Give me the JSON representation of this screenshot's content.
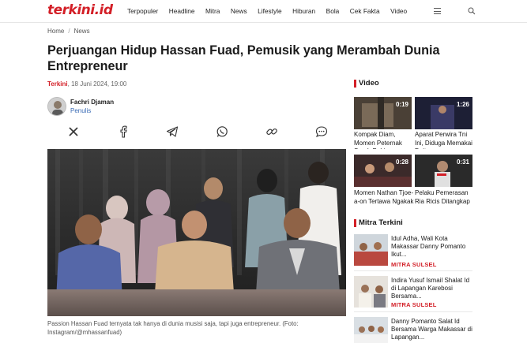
{
  "header": {
    "logo": "terkini.id",
    "nav": [
      "Terpopuler",
      "Headline",
      "Mitra",
      "News",
      "Lifestyle",
      "Hiburan",
      "Bola",
      "Cek Fakta",
      "Video"
    ],
    "menu_icon": "hamburger-icon",
    "search_icon": "search-icon"
  },
  "breadcrumb": {
    "home": "Home",
    "separator": "/",
    "section": "News"
  },
  "article": {
    "title": "Perjuangan Hidup Hassan Fuad, Pemusik yang Merambah Dunia Entrepreneur",
    "source": "Terkini",
    "date": ", 18 Juni 2024, 19:00",
    "author": {
      "name": "Fachri Djaman",
      "role": "Penulis"
    },
    "share_icons": [
      "x-icon",
      "facebook-icon",
      "telegram-icon",
      "whatsapp-icon",
      "link-icon",
      "comment-icon"
    ],
    "caption": "Passion Hassan Fuad ternyata tak hanya di dunia musisi saja, tapi juga entrepreneur. (Foto: Instagram/@mhassanfuad)"
  },
  "sidebar": {
    "video_heading": "Video",
    "videos": [
      {
        "duration": "0:19",
        "title": "Kompak Diam, Momen Peternak Suruh Bahinya"
      },
      {
        "duration": "1:26",
        "title": "Aparat Perwira Tni Ini, Diduga Memakai Duit"
      },
      {
        "duration": "0:28",
        "title": "Momen Nathan Tjoe-a-on Tertawa Ngakak"
      },
      {
        "duration": "0:31",
        "title": "Pelaku Pemerasan Ria Ricis Ditangkap"
      }
    ],
    "mitra_heading": "Mitra Terkini",
    "mitra": [
      {
        "title": "Idul Adha, Wali Kota Makassar Danny Pomanto Ikut...",
        "source": "MITRA SULSEL"
      },
      {
        "title": "Indira Yusuf Ismail Shalat Id di Lapangan Karebosi Bersama...",
        "source": "MITRA SULSEL"
      },
      {
        "title": "Danny Pomanto Salat Id Bersama Warga Makassar di Lapangan...",
        "source": ""
      }
    ]
  },
  "colors": {
    "brand": "#d31f27",
    "link": "#3a6bb5",
    "text": "#1a1a1a"
  }
}
